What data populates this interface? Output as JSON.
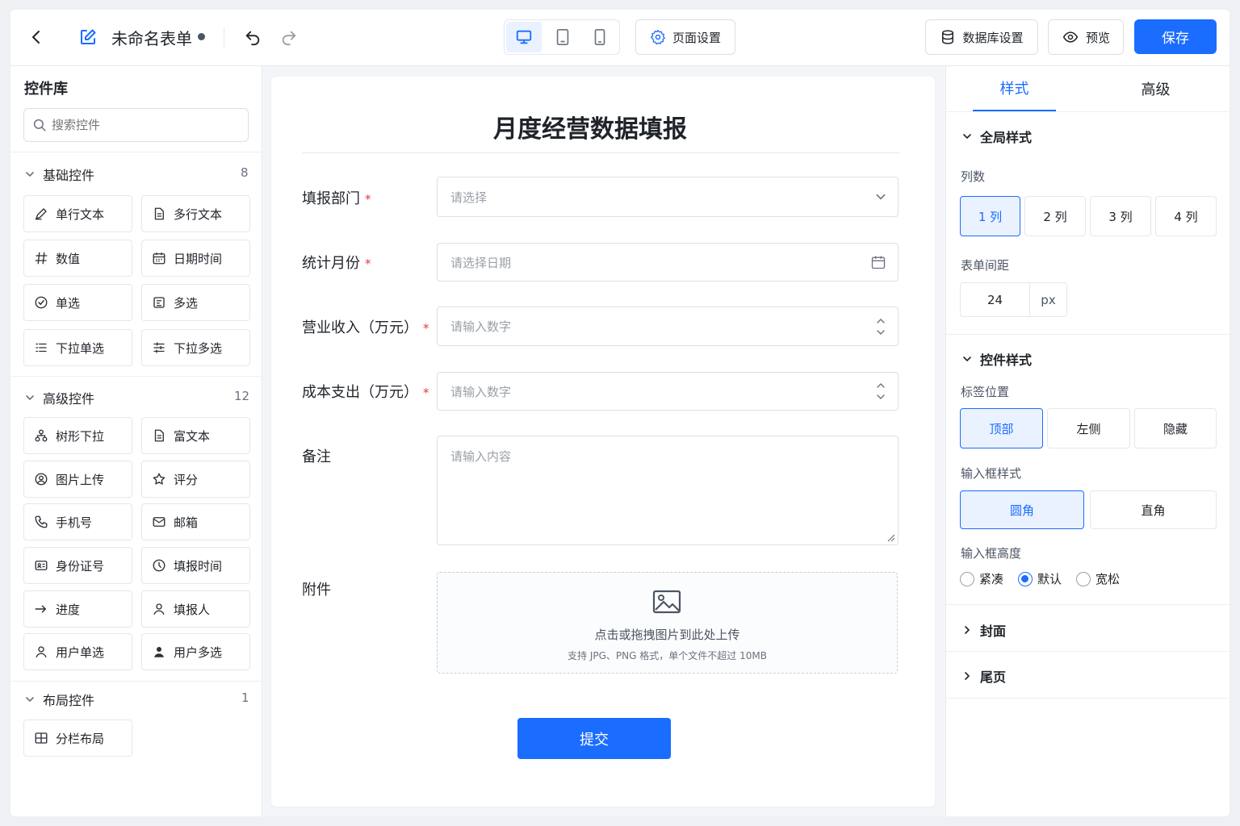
{
  "topbar": {
    "title": "未命名表单",
    "page_settings_label": "页面设置",
    "db_settings_label": "数据库设置",
    "preview_label": "预览",
    "save_label": "保存"
  },
  "library": {
    "title": "控件库",
    "search_placeholder": "搜索控件",
    "basic": {
      "title": "基础控件",
      "count": "8",
      "items": [
        "单行文本",
        "多行文本",
        "数值",
        "日期时间",
        "单选",
        "多选",
        "下拉单选",
        "下拉多选"
      ]
    },
    "advanced": {
      "title": "高级控件",
      "count": "12",
      "items": [
        "树形下拉",
        "富文本",
        "图片上传",
        "评分",
        "手机号",
        "邮箱",
        "身份证号",
        "填报时间",
        "进度",
        "填报人",
        "用户单选",
        "用户多选"
      ]
    },
    "layout": {
      "title": "布局控件",
      "count": "1",
      "items": [
        "分栏布局"
      ]
    }
  },
  "form": {
    "title": "月度经营数据填报",
    "fields": [
      {
        "label": "填报部门",
        "required": "*",
        "placeholder": "请选择"
      },
      {
        "label": "统计月份",
        "required": "*",
        "placeholder": "请选择日期"
      },
      {
        "label": "营业收入（万元）",
        "required": "*",
        "placeholder": "请输入数字"
      },
      {
        "label": "成本支出（万元）",
        "required": "*",
        "placeholder": "请输入数字"
      },
      {
        "label": "备注",
        "placeholder": "请输入内容"
      },
      {
        "label": "附件"
      }
    ],
    "upload_text": "点击或拖拽图片到此处上传",
    "upload_hint": "支持 JPG、PNG 格式，单个文件不超过 10MB",
    "submit_label": "提交"
  },
  "props": {
    "tabs": [
      "样式",
      "高级"
    ],
    "global_title": "全局样式",
    "columns_label": "列数",
    "columns": [
      "1 列",
      "2 列",
      "3 列",
      "4 列"
    ],
    "columns_selected": "1 列",
    "spacing_label": "表单间距",
    "spacing_value": "24",
    "spacing_unit": "px",
    "control_title": "控件样式",
    "label_pos_label": "标签位置",
    "label_pos": [
      "顶部",
      "左侧",
      "隐藏"
    ],
    "label_pos_selected": "顶部",
    "input_style_label": "输入框样式",
    "input_styles": [
      "圆角",
      "直角"
    ],
    "input_style_selected": "圆角",
    "input_height_label": "输入框高度",
    "heights": [
      "紧凑",
      "默认",
      "宽松"
    ],
    "height_selected": "默认",
    "cover_title": "封面",
    "footer_title": "尾页"
  },
  "colors": {
    "accent": "#1a6dff",
    "required": "#e53935"
  }
}
